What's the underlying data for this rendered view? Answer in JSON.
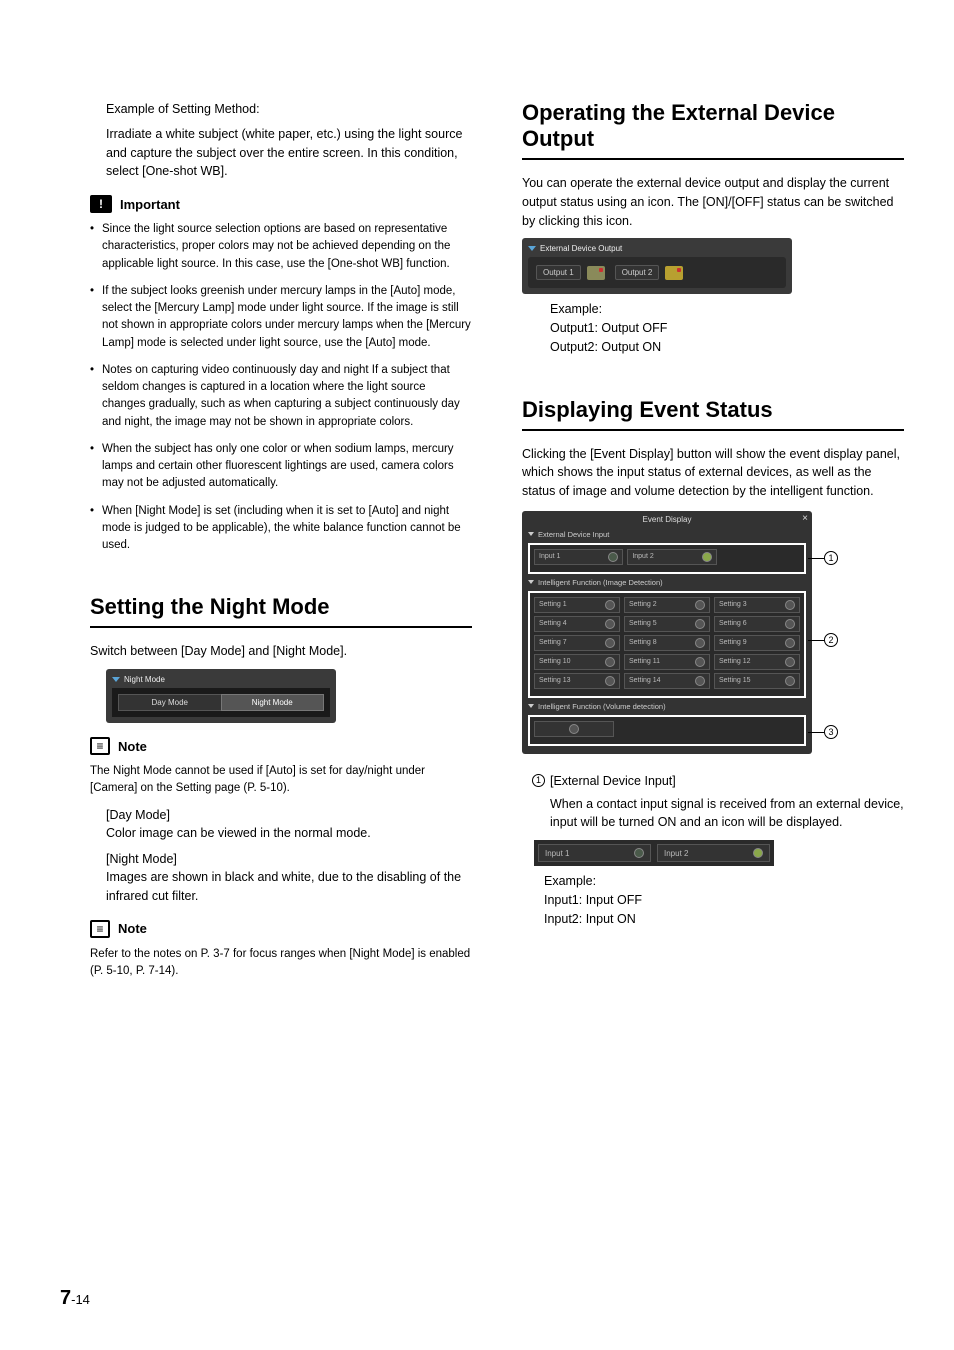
{
  "left": {
    "intro": {
      "line1": "Example of Setting Method:",
      "line2": "Irradiate a white subject (white paper, etc.) using the light source and capture the subject over the entire screen. In this condition, select [One-shot WB]."
    },
    "important_label": "Important",
    "important_bullets": [
      "Since the light source selection options are based on representative characteristics, proper colors may not be achieved depending on the applicable light source. In this case, use the [One-shot WB] function.",
      "If the subject looks greenish under mercury lamps in the [Auto] mode, select the [Mercury Lamp] mode under light source. If the image is still not shown in appropriate colors under mercury lamps when the [Mercury Lamp] mode is selected under light source, use the [Auto] mode.",
      "Notes on capturing video continuously day and night\nIf a subject that seldom changes is captured in a location where the light source changes gradually, such as when capturing a subject continuously day and night, the image may not be shown in appropriate colors.",
      "When the subject has only one color or when sodium lamps, mercury lamps and certain other fluorescent lightings are used, camera colors may not be adjusted automatically.",
      "When [Night Mode] is set (including when it is set to [Auto] and night mode is judged to be applicable), the white balance function cannot be used."
    ],
    "night_heading": "Setting the Night Mode",
    "night_intro": "Switch between [Day Mode] and [Night Mode].",
    "night_panel": {
      "title": "Night Mode",
      "day": "Day Mode",
      "night": "Night Mode"
    },
    "note_label": "Note",
    "note1": "The Night Mode cannot be used if [Auto] is set for day/night under [Camera] on the Setting page (P. 5-10).",
    "day_label": "[Day Mode]",
    "day_desc": "Color image can be viewed in the normal mode.",
    "nightm_label": "[Night Mode]",
    "nightm_desc": "Images are shown in black and white, due to the disabling of the infrared cut filter.",
    "note2": "Refer to the notes on P. 3-7 for focus ranges when [Night Mode] is enabled (P. 5-10, P. 7-14)."
  },
  "right": {
    "op_heading": "Operating the External Device Output",
    "op_intro": "You can operate the external device output and display the current output status using an icon. The [ON]/[OFF] status can be switched by clicking this icon.",
    "op_panel": {
      "title": "External Device Output",
      "out1": "Output 1",
      "out2": "Output 2"
    },
    "op_example": {
      "l1": "Example:",
      "l2": "Output1: Output OFF",
      "l3": "Output2: Output ON"
    },
    "ev_heading": "Displaying Event Status",
    "ev_intro": "Clicking the [Event Display] button will show the event display panel, which shows the input status of external devices, as well as the status of image and volume detection by the intelligent function.",
    "ev_panel": {
      "title": "Event Display",
      "sec1": "External Device Input",
      "in1": "Input 1",
      "in2": "Input 2",
      "sec2": "Intelligent Function (Image Detection)",
      "settings": [
        "Setting 1",
        "Setting 2",
        "Setting 3",
        "Setting 4",
        "Setting 5",
        "Setting 6",
        "Setting 7",
        "Setting 8",
        "Setting 9",
        "Setting 10",
        "Setting 11",
        "Setting 12",
        "Setting 13",
        "Setting 14",
        "Setting 15"
      ],
      "sec3": "Intelligent Function (Volume detection)"
    },
    "ev_item1_label": "[External Device Input]",
    "ev_item1_desc": "When a contact input signal is received from an external device, input will be turned ON and an icon will be displayed.",
    "input_strip": {
      "in1": "Input 1",
      "in2": "Input 2"
    },
    "input_example": {
      "l1": "Example:",
      "l2": "Input1: Input OFF",
      "l3": "Input2: Input ON"
    }
  },
  "page_num": {
    "chapter": "7",
    "page": "-14"
  }
}
